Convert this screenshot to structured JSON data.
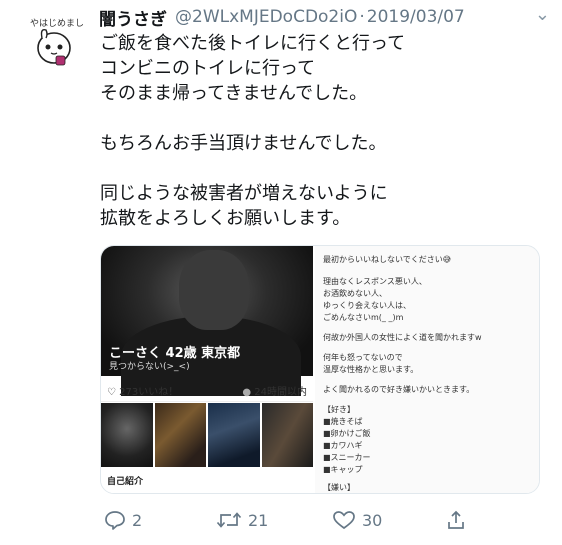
{
  "avatar": {
    "tag": "やはじめまし"
  },
  "tweet": {
    "name": "闇うさぎ",
    "handle": "@2WLxMJEDoCDo2iO",
    "separator": "·",
    "date": "2019/03/07",
    "lines": [
      "ご飯を食べた後トイレに行くと行って",
      "コンビニのトイレに行って",
      "そのまま帰ってきませんでした。",
      "",
      "もちろんお手当頂けませんでした。",
      "",
      "同じような被害者が増えないように",
      "拡散をよろしくお願いします。"
    ]
  },
  "media": {
    "profile_name": "こーさく 42歳 東京都",
    "profile_sub": "見つからない(>_<)",
    "likes": "273いいね！",
    "online": "24時間以内",
    "intro_label": "自己紹介",
    "right_lines": [
      "最初からいいねしないでください😅",
      "理由なくレスポンス悪い人、",
      "お酒飲めない人、",
      "ゆっくり会えない人は、",
      "ごめんなさいm(_ _)m",
      "何故か外国人の女性によく道を聞かれますw",
      "何年も怒ってないので",
      "温厚な性格かと思います。",
      "よく聞かれるので好き嫌いかいときます。",
      "【好き】",
      "■焼きそば",
      "■卵かけご飯",
      "■カワハギ",
      "■スニーカー",
      "■キャップ",
      "【嫌い】"
    ]
  },
  "actions": {
    "replies": "2",
    "retweets": "21",
    "likes": "30"
  },
  "colors": {
    "secondary": "#657786",
    "text": "#14171a",
    "border": "#e1e8ed"
  }
}
